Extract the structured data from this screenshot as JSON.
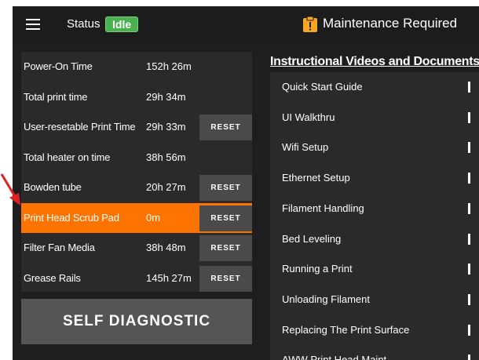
{
  "header": {
    "status_label": "Status",
    "status_value": "Idle",
    "status_color": "#4caf50",
    "warning_icon": "warning-clipboard-icon",
    "maintenance_text": "Maintenance Required"
  },
  "stats": {
    "reset_label": "RESET",
    "rows": [
      {
        "label": "Power-On Time",
        "value": "152h 26m",
        "resettable": false,
        "highlighted": false
      },
      {
        "label": "Total print time",
        "value": "29h 34m",
        "resettable": false,
        "highlighted": false
      },
      {
        "label": "User-resetable Print Time",
        "value": "29h 33m",
        "resettable": true,
        "highlighted": false
      },
      {
        "label": "Total heater on time",
        "value": "38h 56m",
        "resettable": false,
        "highlighted": false
      },
      {
        "label": "Bowden tube",
        "value": "20h 27m",
        "resettable": true,
        "highlighted": false
      },
      {
        "label": "Print Head Scrub Pad",
        "value": "0m",
        "resettable": true,
        "highlighted": true
      },
      {
        "label": "Filter Fan Media",
        "value": "38h 48m",
        "resettable": true,
        "highlighted": false
      },
      {
        "label": "Grease Rails",
        "value": "145h 27m",
        "resettable": true,
        "highlighted": false
      }
    ],
    "highlight_color": "#ff7300"
  },
  "self_diagnostic_label": "SELF DIAGNOSTIC",
  "videos": {
    "title": "Instructional Videos and Documents",
    "items": [
      "Quick Start Guide",
      "UI Walkthru",
      "Wifi Setup",
      "Ethernet Setup",
      "Filament Handling",
      "Bed Leveling",
      "Running a Print",
      "Unloading Filament",
      "Replacing The Print Surface",
      "AWW Print Head Maint"
    ]
  },
  "annotation": {
    "arrow_color": "#e02020"
  }
}
